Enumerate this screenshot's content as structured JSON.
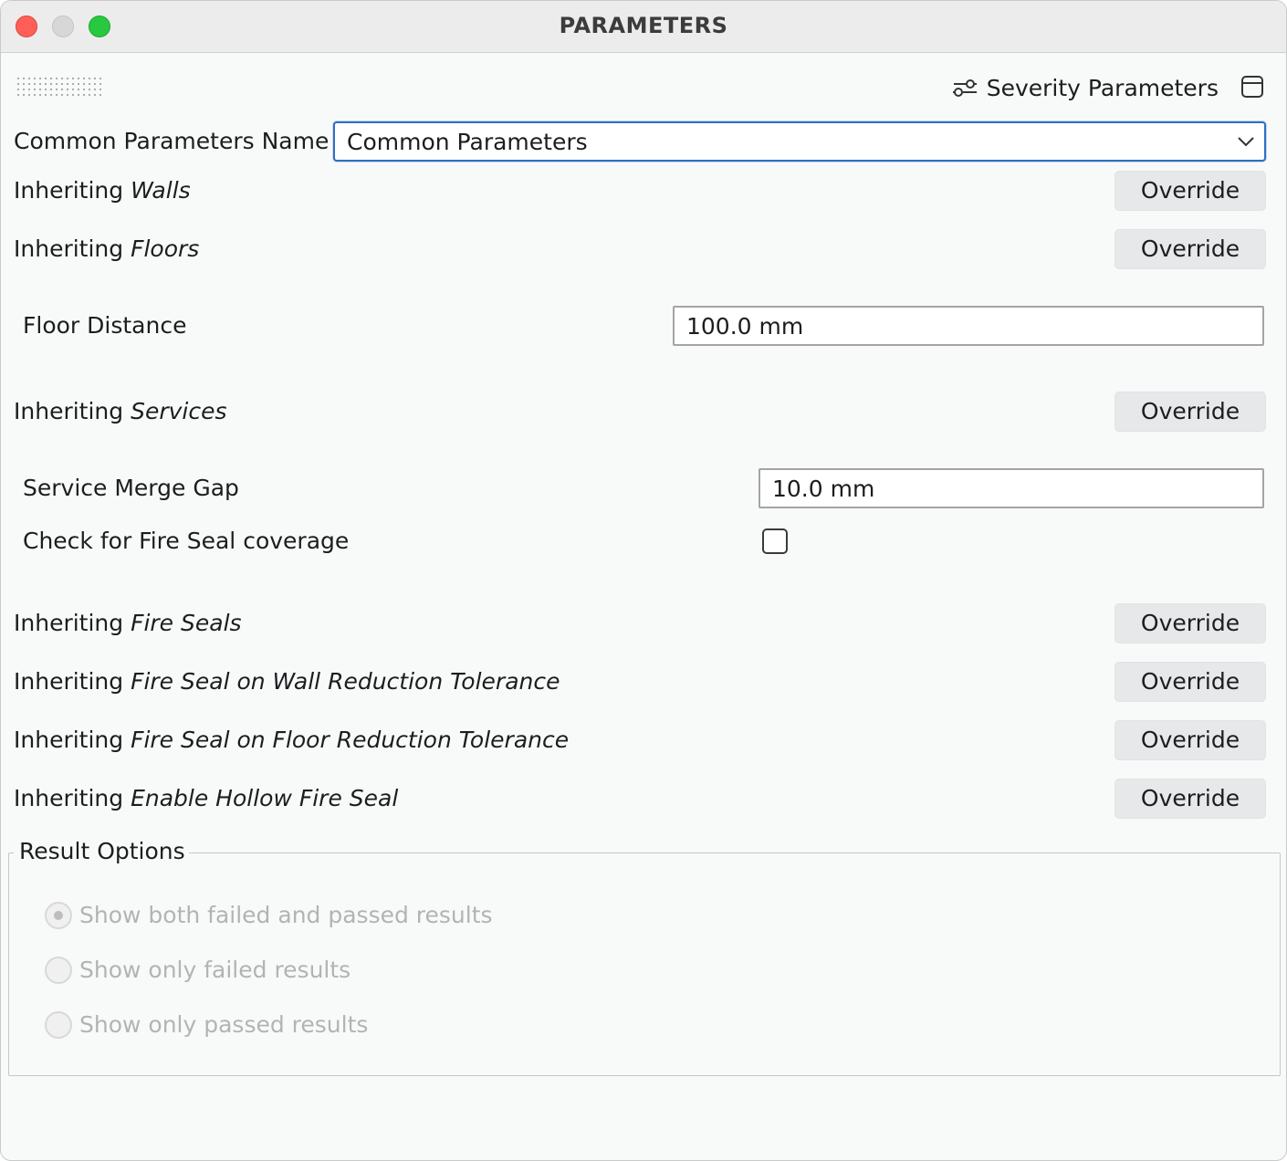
{
  "window": {
    "title": "PARAMETERS"
  },
  "toolbar": {
    "severity_label": "Severity Parameters",
    "severity_icon": "sliders-icon",
    "panel_icon": "panel-icon"
  },
  "common": {
    "label": "Common Parameters Name",
    "selected": "Common Parameters"
  },
  "rows": {
    "walls": {
      "prefix": "Inheriting ",
      "name": "Walls",
      "button": "Override"
    },
    "floors": {
      "prefix": "Inheriting ",
      "name": "Floors",
      "button": "Override"
    },
    "services": {
      "prefix": "Inheriting ",
      "name": "Services",
      "button": "Override"
    },
    "fire_seals": {
      "prefix": "Inheriting ",
      "name": "Fire Seals",
      "button": "Override"
    },
    "wall_tol": {
      "prefix": "Inheriting ",
      "name": "Fire Seal on Wall Reduction Tolerance",
      "button": "Override"
    },
    "floor_tol": {
      "prefix": "Inheriting ",
      "name": "Fire Seal on Floor Reduction Tolerance",
      "button": "Override"
    },
    "hollow": {
      "prefix": "Inheriting ",
      "name": "Enable Hollow Fire Seal",
      "button": "Override"
    }
  },
  "floor_distance": {
    "label": "Floor Distance",
    "value": "100.0 mm"
  },
  "service_merge_gap": {
    "label": "Service Merge Gap",
    "value": "10.0 mm"
  },
  "fire_seal_check": {
    "label": "Check for Fire Seal coverage",
    "checked": false
  },
  "result_options": {
    "title": "Result Options",
    "options": [
      {
        "label": "Show both failed and passed results",
        "selected": true
      },
      {
        "label": "Show only failed results",
        "selected": false
      },
      {
        "label": "Show only passed results",
        "selected": false
      }
    ]
  }
}
